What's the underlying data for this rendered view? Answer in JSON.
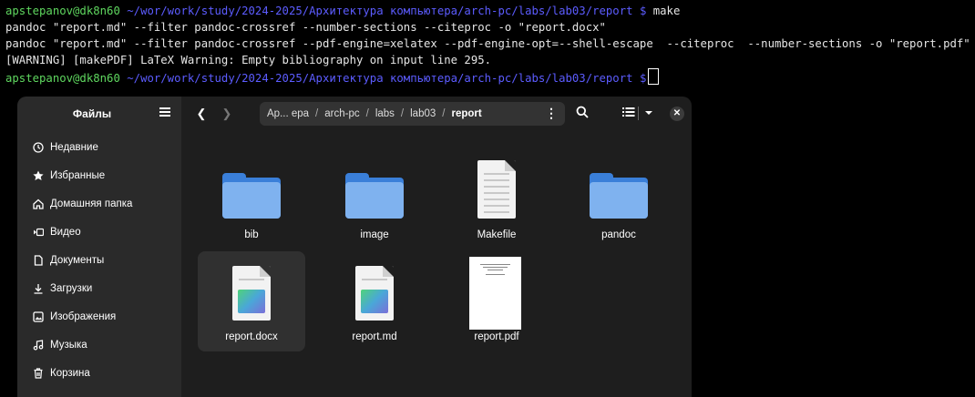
{
  "terminal": {
    "prompt_user": "apstepanov@dk8n60",
    "prompt_path": "~/wor/work/study/2024-2025/Архитектура компьютера/arch-pc/labs/lab03/report",
    "prompt_symbol": "$",
    "command": "make",
    "output": [
      "pandoc \"report.md\" --filter pandoc-crossref --number-sections --citeproc -o \"report.docx\"",
      "pandoc \"report.md\" --filter pandoc-crossref --pdf-engine=xelatex --pdf-engine-opt=--shell-escape  --citeproc  --number-sections -o \"report.pdf\"",
      "[WARNING] [makePDF] LaTeX Warning: Empty bibliography on input line 295."
    ]
  },
  "file_manager": {
    "sidebar_title": "Файлы",
    "sidebar_items": [
      {
        "label": "Недавние",
        "icon": "clock-icon"
      },
      {
        "label": "Избранные",
        "icon": "star-icon"
      },
      {
        "label": "Домашняя папка",
        "icon": "home-icon"
      },
      {
        "label": "Видео",
        "icon": "video-icon"
      },
      {
        "label": "Документы",
        "icon": "document-icon"
      },
      {
        "label": "Загрузки",
        "icon": "download-icon"
      },
      {
        "label": "Изображения",
        "icon": "image-icon"
      },
      {
        "label": "Музыка",
        "icon": "music-icon"
      },
      {
        "label": "Корзина",
        "icon": "trash-icon"
      }
    ],
    "path": [
      "Ар... ера",
      "arch-pc",
      "labs",
      "lab03",
      "report"
    ],
    "files": [
      {
        "name": "bib",
        "type": "folder"
      },
      {
        "name": "image",
        "type": "folder"
      },
      {
        "name": "Makefile",
        "type": "text"
      },
      {
        "name": "pandoc",
        "type": "folder"
      },
      {
        "name": "report.docx",
        "type": "docx"
      },
      {
        "name": "report.md",
        "type": "md"
      },
      {
        "name": "report.pdf",
        "type": "pdf"
      }
    ],
    "selected_file": "report.docx",
    "colors": {
      "folder": "#3a7fd9",
      "folder_front": "#7fb2ef",
      "prompt_user": "#5fd75f",
      "prompt_path": "#5c5cff"
    }
  }
}
